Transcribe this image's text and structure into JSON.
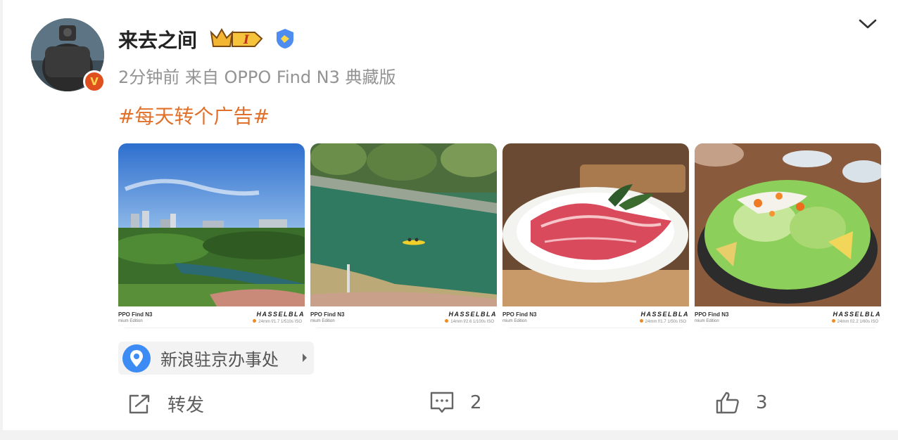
{
  "post": {
    "user_name": "来去之间",
    "vip_level": "I",
    "vbadge": "V",
    "meta": "2分钟前 来自 OPPO Find N3 典藏版",
    "topic": "#每天转个广告#"
  },
  "photos": [
    {
      "device": "PPO Find N3",
      "edition": "mium Edition",
      "brand": "HASSELBLA",
      "spec": "24mm f/1.7 1/510s ISO"
    },
    {
      "device": "PPO Find N3",
      "edition": "mium Edition",
      "brand": "HASSELBLA",
      "spec": "14mm f/2.6 1/100s ISO"
    },
    {
      "device": "PPO Find N3",
      "edition": "mium Edition",
      "brand": "HASSELBLA",
      "spec": "24mm f/1.7 1/50s ISO"
    },
    {
      "device": "PPO Find N3",
      "edition": "mium Edition",
      "brand": "HASSELBLA",
      "spec": "24mm f/2.2 1/60s ISO"
    }
  ],
  "location": {
    "name": "新浪驻京办事处"
  },
  "actions": {
    "repost_label": "转发",
    "comment_count": "2",
    "like_count": "3"
  },
  "icons": [
    "chevron-down-icon",
    "location-pin-icon",
    "share-icon",
    "comment-icon",
    "thumbs-up-icon",
    "crown-vip-icon",
    "verified-badge-icon"
  ],
  "colors": {
    "topic": "#e0702a",
    "location_pin": "#3d8bf5",
    "vbadge": "#e0501e"
  }
}
